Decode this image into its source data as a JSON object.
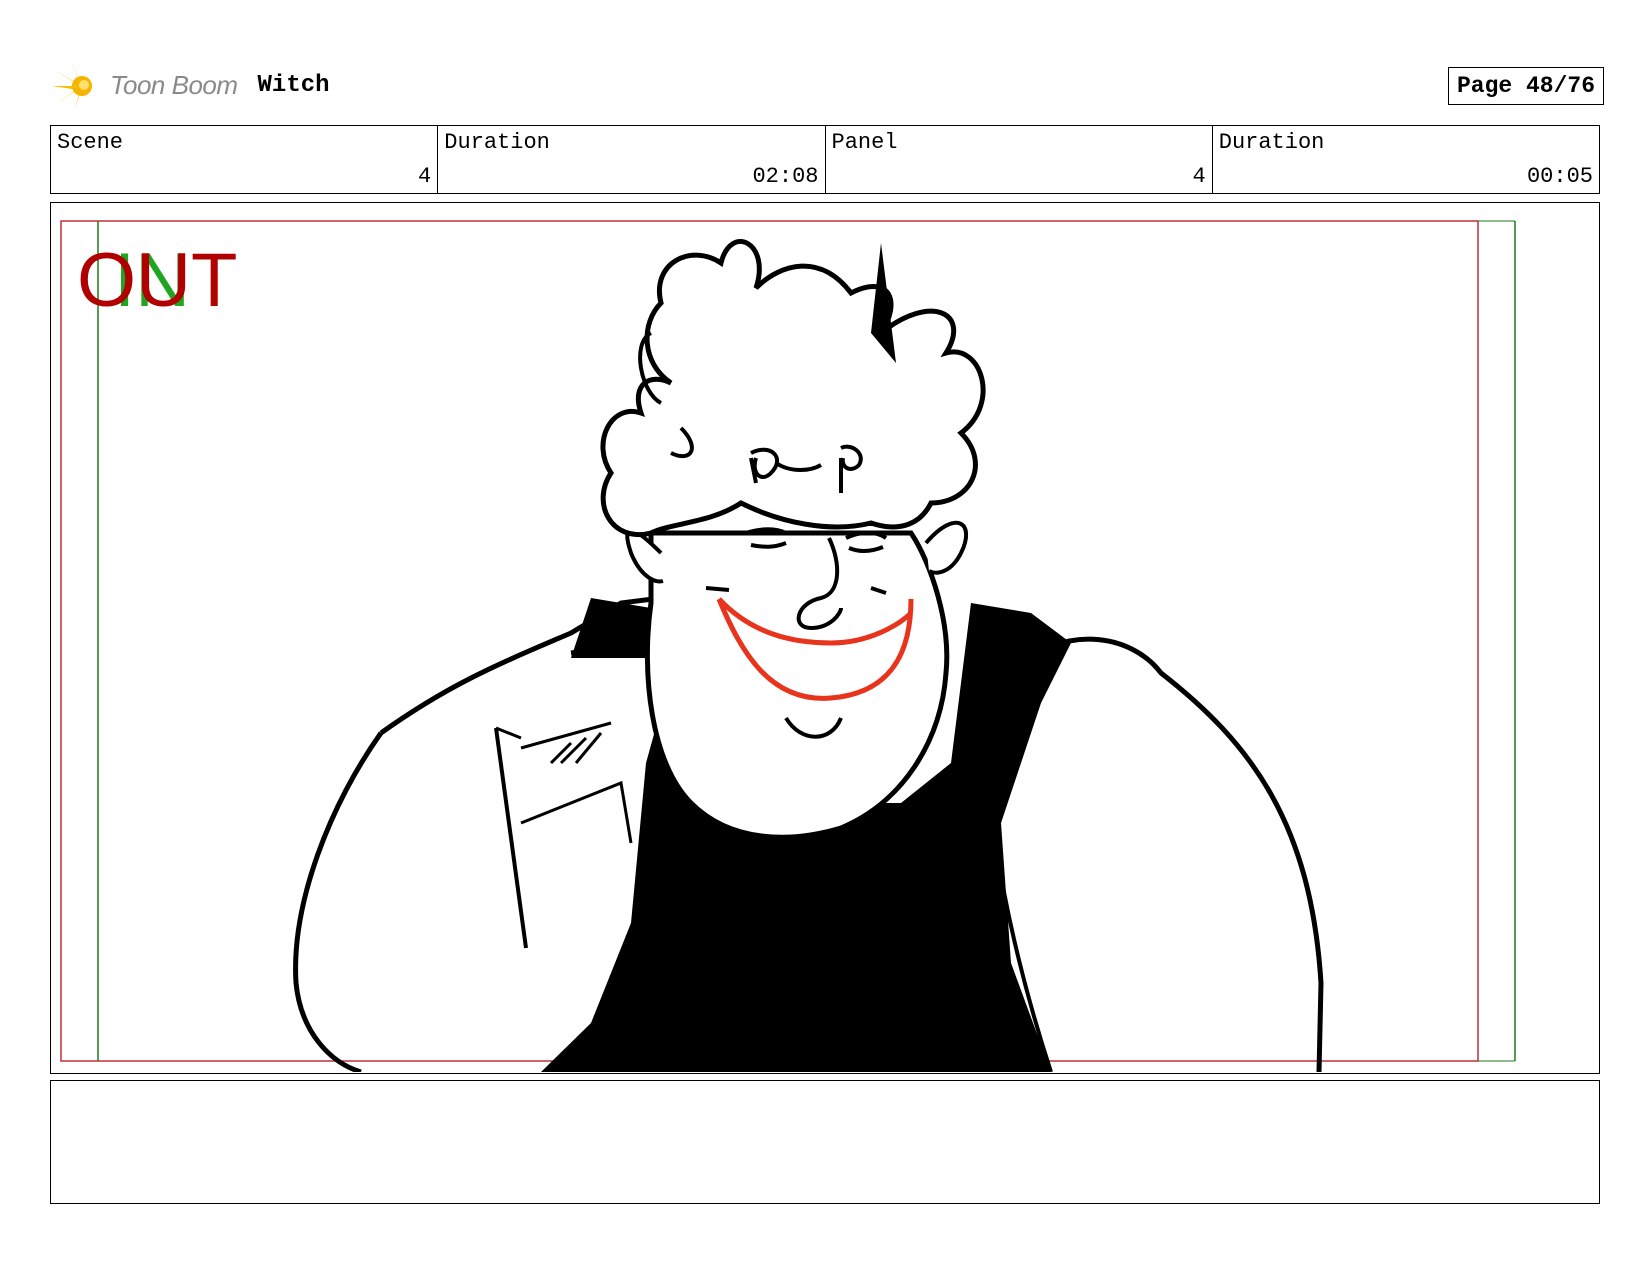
{
  "header": {
    "logo_text": "Toon Boom",
    "project_title": "Witch",
    "page_label": "Page 48/76"
  },
  "info": {
    "scene_label": "Scene",
    "scene_value": "4",
    "scene_duration_label": "Duration",
    "scene_duration_value": "02:08",
    "panel_label": "Panel",
    "panel_value": "4",
    "panel_duration_label": "Duration",
    "panel_duration_value": "00:05"
  },
  "panel": {
    "in_label": "IN",
    "out_label": "OUT",
    "in_color": "#1fa51f",
    "out_color": "#b00000",
    "mouth_color": "#e8341c"
  },
  "notes": {
    "text": ""
  }
}
